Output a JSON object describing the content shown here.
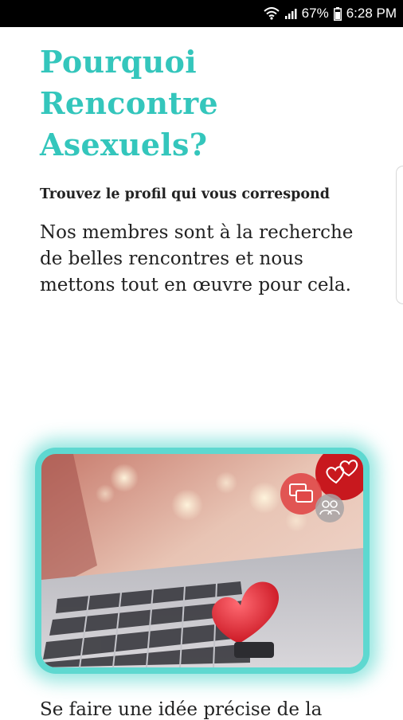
{
  "status_bar": {
    "battery": "67%",
    "time": "6:28 PM",
    "icons": [
      "wifi-icon",
      "signal-icon",
      "battery-icon"
    ]
  },
  "headline": {
    "line1": "Pourquoi",
    "line2": "Rencontre",
    "line3": "Asexuels?"
  },
  "subtitle": "Trouvez le profil qui vous correspond",
  "body": "Nos membres sont à la recherche de belles rencontres et nous mettons tout en œuvre pour cela.",
  "hero": {
    "icons": [
      "hearts-icon",
      "chat-bubbles-icon",
      "people-icon"
    ]
  },
  "bottom_text": "Se faire une idée précise de la",
  "colors": {
    "accent": "#34c6bc",
    "heart_badge": "#c8181e",
    "text": "#222222"
  }
}
